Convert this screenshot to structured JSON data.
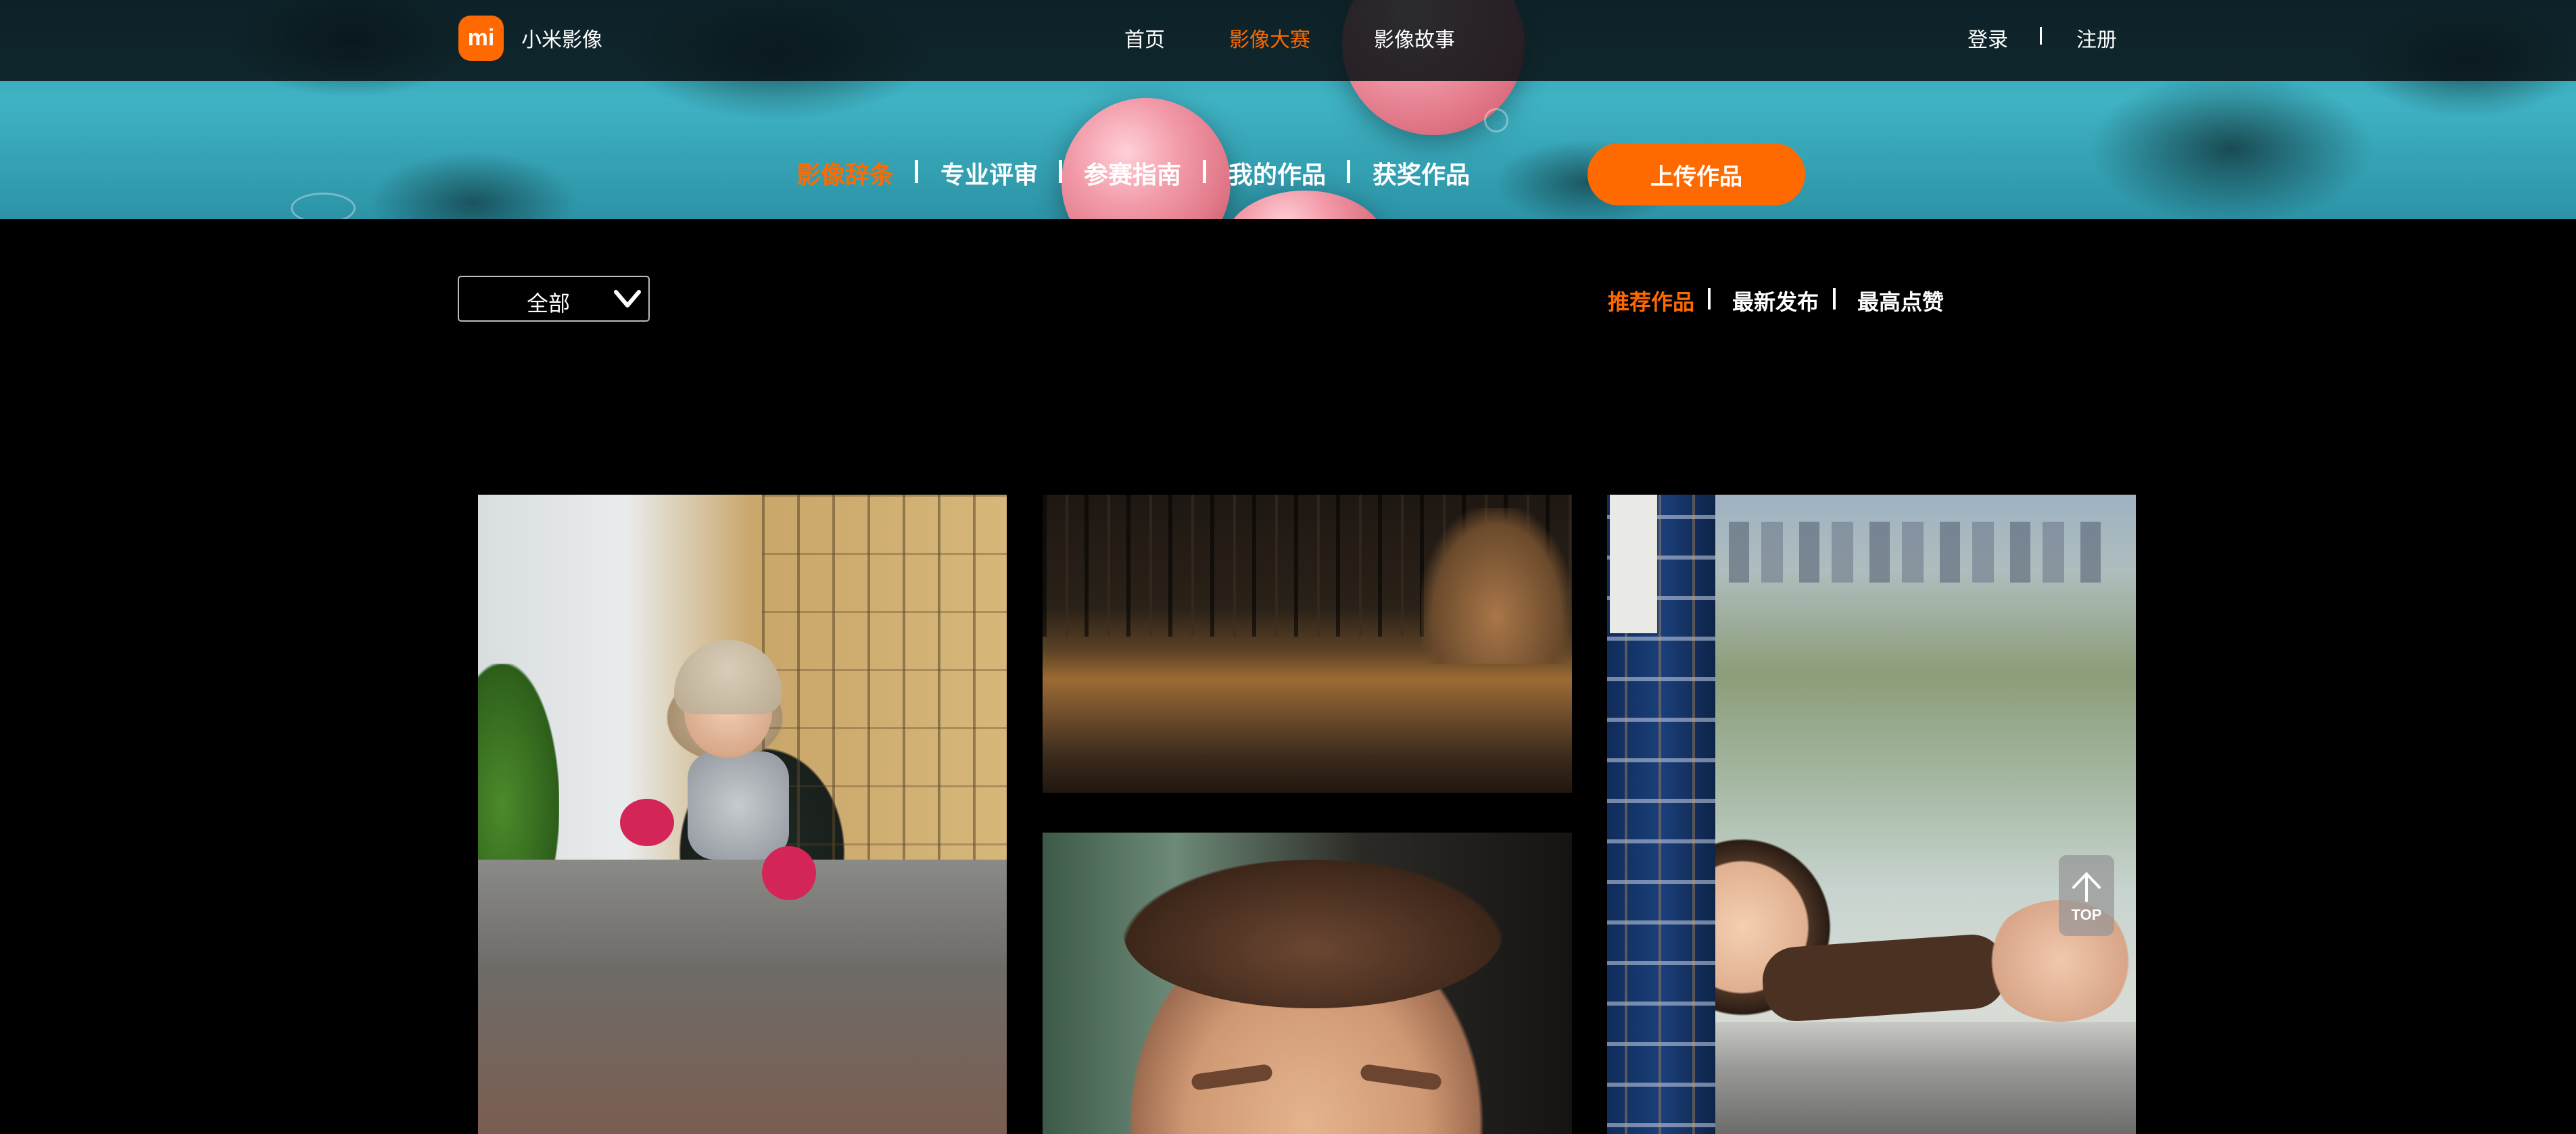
{
  "brand": {
    "logo_text": "mi",
    "name": "小米影像",
    "accent": "#ff6a00"
  },
  "top_nav": [
    {
      "label": "首页",
      "active": false
    },
    {
      "label": "影像大赛",
      "active": true
    },
    {
      "label": "影像故事",
      "active": false
    }
  ],
  "auth": {
    "login": "登录",
    "register": "注册"
  },
  "sub_nav": [
    {
      "label": "影像辞条",
      "active": true
    },
    {
      "label": "专业评审",
      "active": false
    },
    {
      "label": "参赛指南",
      "active": false
    },
    {
      "label": "我的作品",
      "active": false
    },
    {
      "label": "获奖作品",
      "active": false
    }
  ],
  "upload_button": "上传作品",
  "filter": {
    "selected": "全部",
    "icon": "chevron-down-icon"
  },
  "sort_tabs": [
    {
      "label": "推荐作品",
      "active": true
    },
    {
      "label": "最新发布",
      "active": false
    },
    {
      "label": "最高点赞",
      "active": false
    }
  ],
  "photos": [
    {
      "subject": "child-in-hat-sitting-by-window"
    },
    {
      "subject": "field-with-bare-trees"
    },
    {
      "subject": "baby-face-closeup"
    },
    {
      "subject": "girl-looking-out-train-window"
    }
  ],
  "back_to_top": {
    "label": "TOP",
    "icon": "arrow-up-icon"
  }
}
